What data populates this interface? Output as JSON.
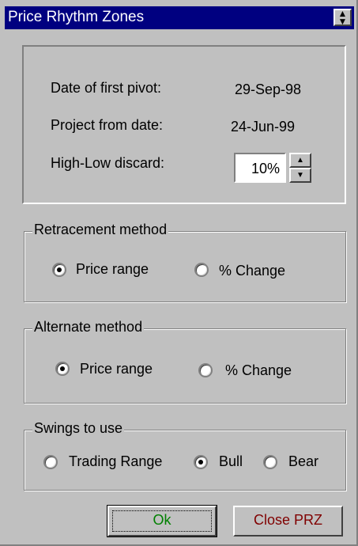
{
  "window": {
    "title": "Price Rhythm Zones",
    "title_bar_color": "#000080",
    "menu_icon": "up-down-arrows-icon"
  },
  "info": {
    "first_pivot_label": "Date of first pivot:",
    "first_pivot_value": "29-Sep-98",
    "project_from_label": "Project from date:",
    "project_from_value": "24-Jun-99",
    "discard_label": "High-Low discard:",
    "discard_value": "10%"
  },
  "retracement": {
    "legend": "Retracement method",
    "options": [
      "Price range",
      "% Change"
    ],
    "selected": "Price range"
  },
  "alternate": {
    "legend": "Alternate method",
    "options": [
      "Price range",
      "% Change"
    ],
    "selected": "Price range"
  },
  "swings": {
    "legend": "Swings to use",
    "options": [
      "Trading Range",
      "Bull",
      "Bear"
    ],
    "selected": "Bull"
  },
  "buttons": {
    "ok_label": "Ok",
    "ok_color": "#008000",
    "close_label": "Close PRZ",
    "close_color": "#800000"
  }
}
